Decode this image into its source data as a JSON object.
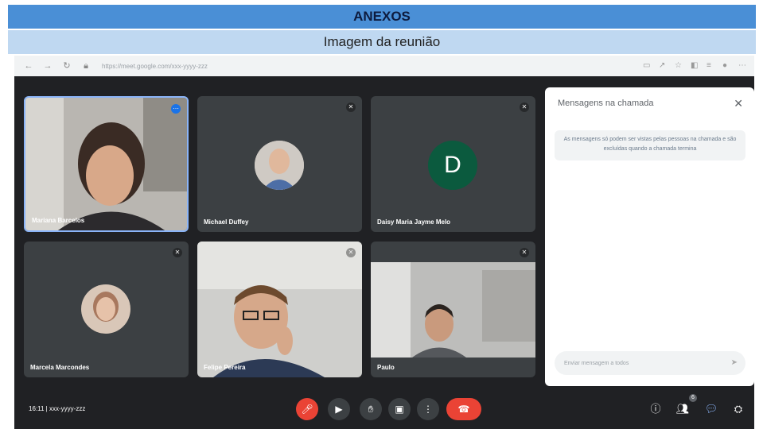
{
  "header": {
    "title": "ANEXOS",
    "subtitle": "Imagem da reunião"
  },
  "browser": {
    "url": "https://meet.google.com/xxx-yyyy-zzz"
  },
  "participants": [
    {
      "name": "Mariana Barcelos",
      "type": "video"
    },
    {
      "name": "Michael Duffey",
      "type": "avatar-photo"
    },
    {
      "name": "Daisy Maria Jayme Melo",
      "type": "letter",
      "initial": "D",
      "avatar_color": "#0b5a3e"
    },
    {
      "name": "Marcela Marcondes",
      "type": "avatar-photo"
    },
    {
      "name": "Felipe Pereira",
      "type": "video"
    },
    {
      "name": "Paulo",
      "type": "video"
    }
  ],
  "chat": {
    "title": "Mensagens na chamada",
    "notice": "As mensagens só podem ser vistas pelas pessoas na chamada e são excluídas quando a chamada termina",
    "input_placeholder": "Enviar mensagem a todos",
    "close_icon": "close-icon",
    "send_icon": "send-icon"
  },
  "meeting": {
    "time": "16:11",
    "code": "xxx-yyyy-zzz"
  },
  "people_count": "6",
  "colors": {
    "header_band": "#4a8fd6",
    "subtitle_band": "#bfd8f1",
    "meet_bg": "#202124",
    "tile_bg": "#3c4043",
    "hangup": "#ea4335",
    "active_speaker": "#8ab4f8"
  }
}
